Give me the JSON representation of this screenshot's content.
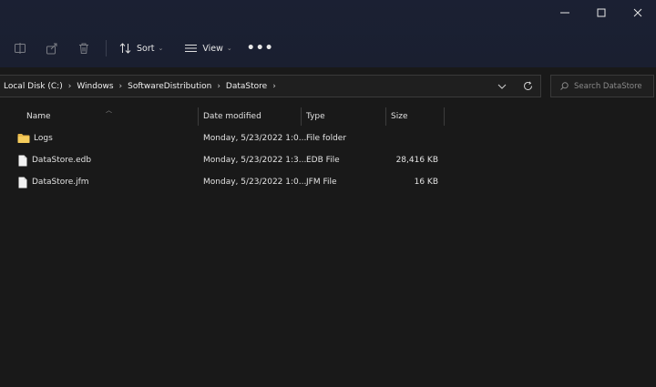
{
  "window": {
    "controls": {
      "minimize": "minimize-icon",
      "maximize": "maximize-icon",
      "close": "close-icon"
    }
  },
  "toolbar": {
    "icons": [
      "rename-icon",
      "share-icon",
      "delete-icon"
    ],
    "sort_label": "Sort",
    "view_label": "View",
    "more_label": "•••"
  },
  "address": {
    "crumbs": [
      "Local Disk (C:)",
      "Windows",
      "SoftwareDistribution",
      "DataStore"
    ],
    "chevron": "›"
  },
  "search": {
    "placeholder": "Search DataStore"
  },
  "columns": {
    "name": "Name",
    "date": "Date modified",
    "type": "Type",
    "size": "Size"
  },
  "files": [
    {
      "name": "Logs",
      "date": "Monday, 5/23/2022 1:0...",
      "type": "File folder",
      "size": "",
      "icon": "folder-icon"
    },
    {
      "name": "DataStore.edb",
      "date": "Monday, 5/23/2022 1:3...",
      "type": "EDB File",
      "size": "28,416 KB",
      "icon": "file-icon"
    },
    {
      "name": "DataStore.jfm",
      "date": "Monday, 5/23/2022 1:0...",
      "type": "JFM File",
      "size": "16 KB",
      "icon": "file-icon"
    }
  ],
  "colors": {
    "background": "#191919",
    "titlebar": "#1b2033",
    "folder": "#e8b84a"
  }
}
